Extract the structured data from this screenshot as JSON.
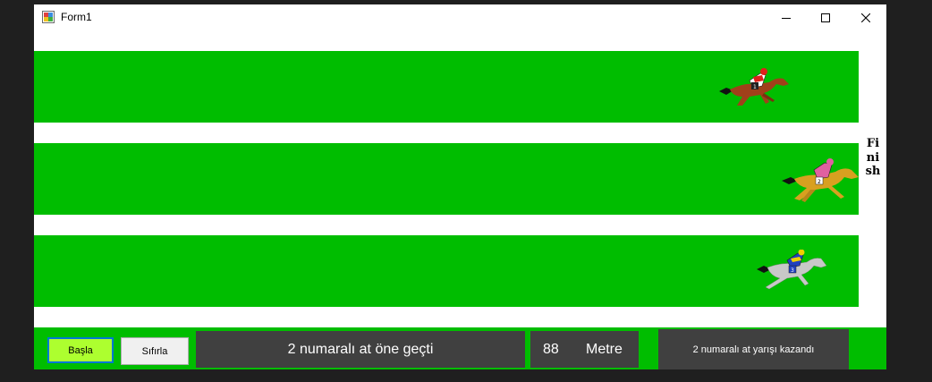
{
  "window": {
    "title": "Form1"
  },
  "track": {
    "lane_color": "#00bd00",
    "finish_label": "Finish",
    "horses": [
      {
        "number": 1,
        "icon": "horse-jockey-brown-icon",
        "body_color": "#a0401a",
        "silks_color": "#e0201a"
      },
      {
        "number": 2,
        "icon": "horse-jockey-tan-icon",
        "body_color": "#d8a020",
        "silks_color": "#e060a0"
      },
      {
        "number": 3,
        "icon": "horse-jockey-grey-icon",
        "body_color": "#c8c8c8",
        "silks_color": "#2040c0"
      }
    ]
  },
  "controls": {
    "start_label": "Başla",
    "reset_label": "Sıfırla",
    "status_text": "2 numaralı at  öne geçti",
    "distance_value": "88",
    "distance_unit": "Metre",
    "winner_text": "2 numaralı at yarışı kazandı"
  },
  "colors": {
    "accent_focus": "#0078d7",
    "start_button": "#adff2f",
    "panel_bg": "#404040"
  }
}
